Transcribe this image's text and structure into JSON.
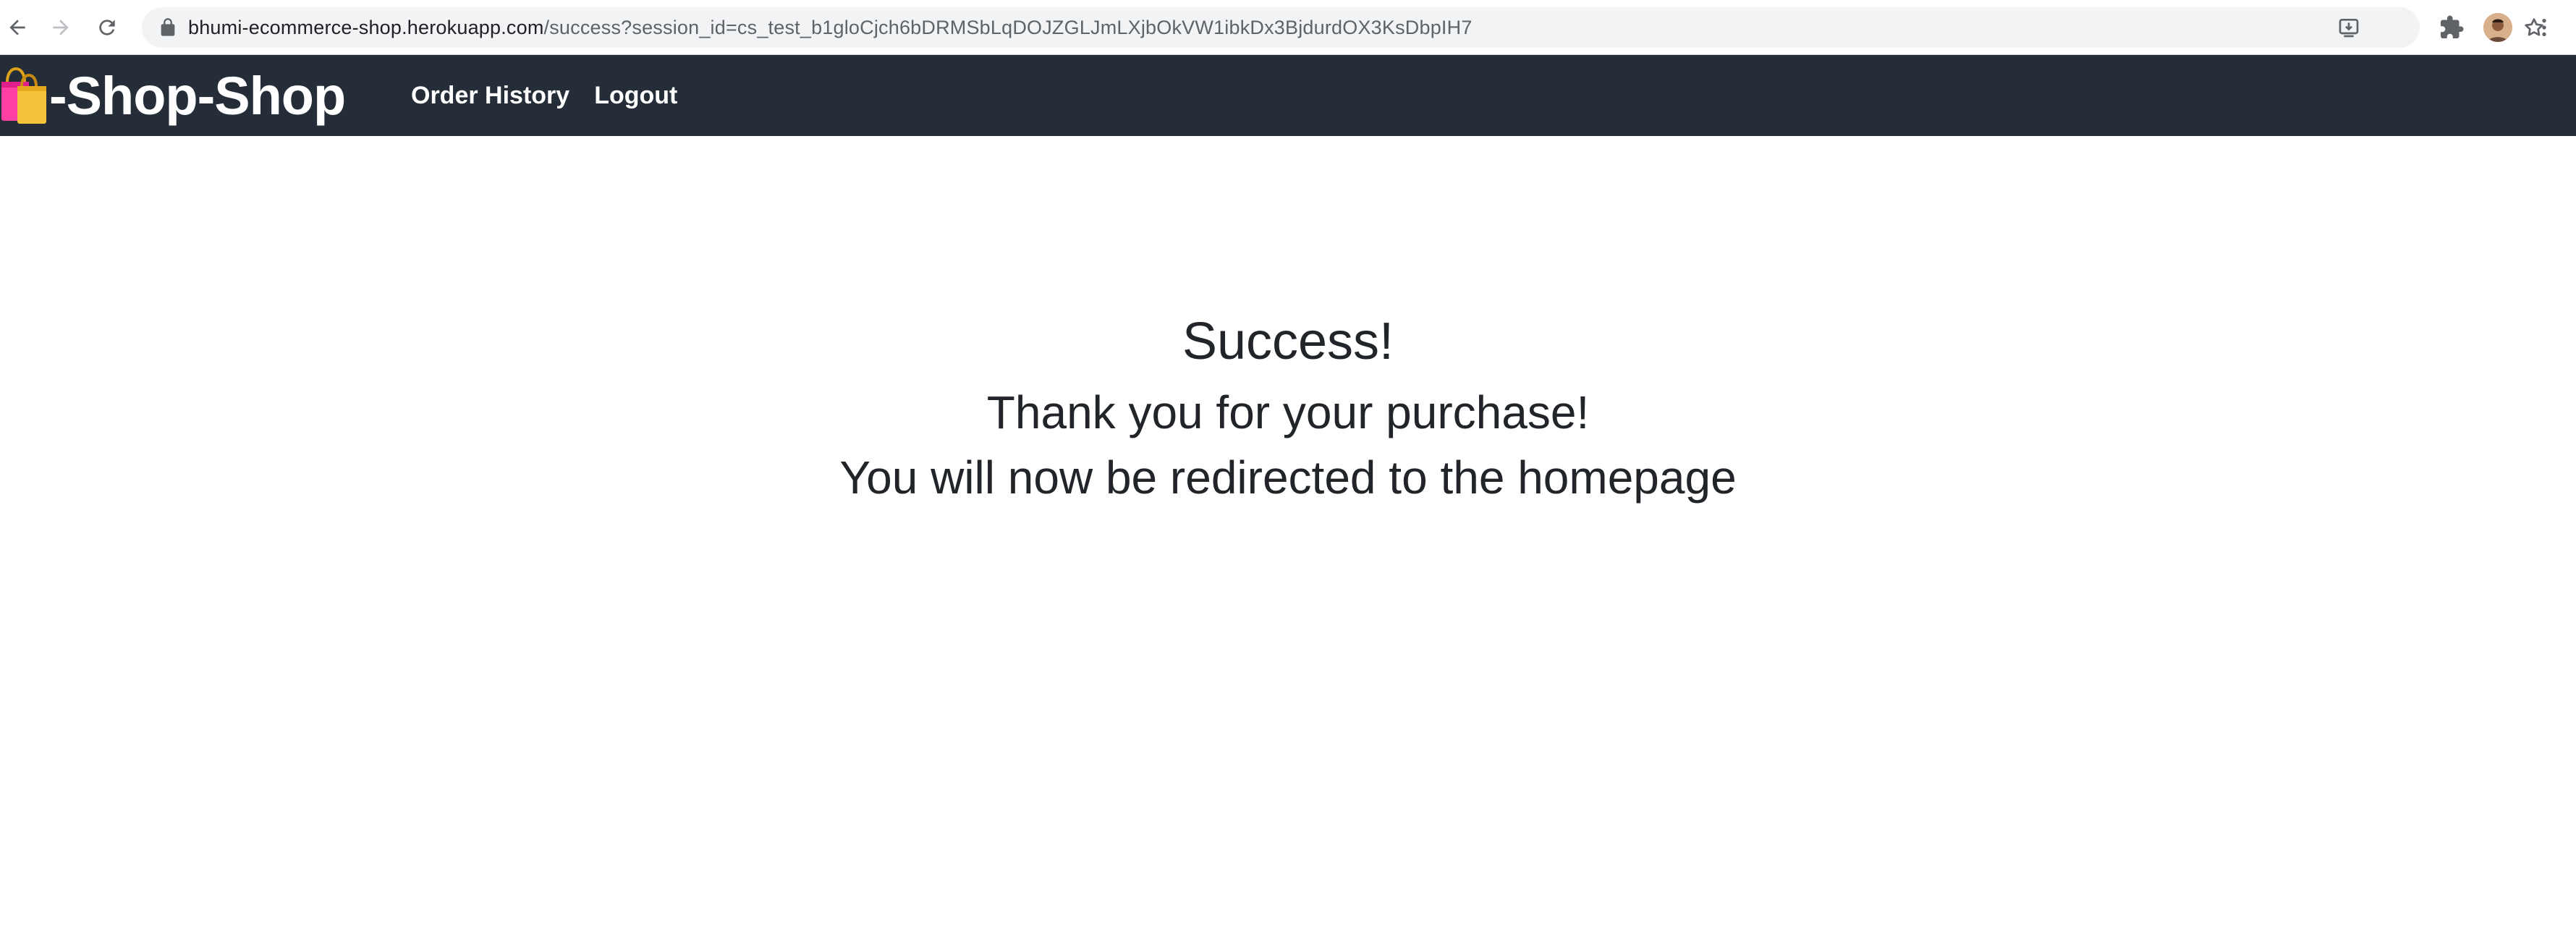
{
  "browser": {
    "url_host": "bhumi-ecommerce-shop.herokuapp.com",
    "url_path": "/success?session_id=cs_test_b1gloCjch6bDRMSbLqDOJZGLJmLXjbOkVW1ibkDx3BjdurdOX3KsDbpIH7",
    "icons": {
      "back": "back-arrow-icon",
      "forward": "forward-arrow-icon",
      "reload": "reload-icon",
      "lock": "lock-icon",
      "install": "install-app-icon",
      "bookmark": "star-icon",
      "extensions": "puzzle-icon",
      "profile": "avatar",
      "menu": "kebab-menu-icon"
    }
  },
  "header": {
    "brand_text": "-Shop-Shop",
    "brand_icon": "shopping-bags-icon",
    "nav": {
      "order_history": "Order History",
      "logout": "Logout"
    },
    "background": "#252d39"
  },
  "main": {
    "title": "Success!",
    "thanks": "Thank you for your purchase!",
    "redirect": "You will now be redirected to the homepage"
  },
  "colors": {
    "text": "#212529",
    "header_bg": "#252d39",
    "omnibox_bg": "#f1f3f4"
  }
}
